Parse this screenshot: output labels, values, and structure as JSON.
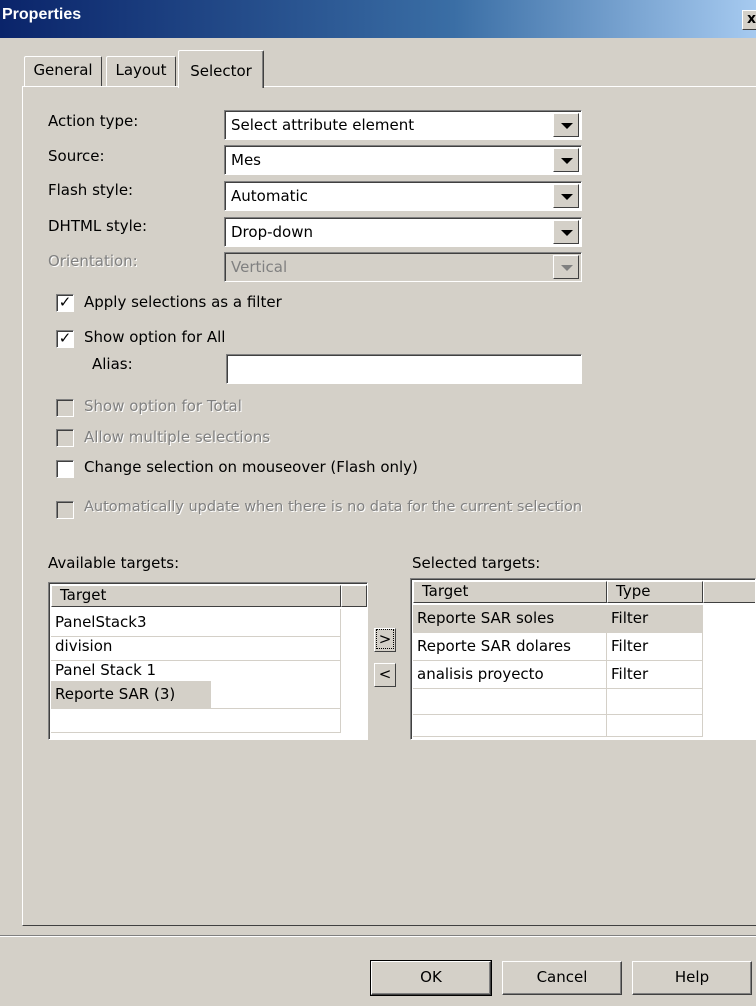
{
  "window": {
    "title": "Properties",
    "close_glyph": "x"
  },
  "tabs": [
    {
      "label": "General"
    },
    {
      "label": "Layout"
    },
    {
      "label": "Selector"
    }
  ],
  "form": {
    "action_type": {
      "label": "Action type:",
      "value": "Select attribute element"
    },
    "source": {
      "label": "Source:",
      "value": "Mes"
    },
    "flash_style": {
      "label": "Flash style:",
      "value": "Automatic"
    },
    "dhtml_style": {
      "label": "DHTML style:",
      "value": "Drop-down"
    },
    "orientation": {
      "label": "Orientation:",
      "value": "Vertical"
    }
  },
  "checks": {
    "apply_filter": {
      "label": "Apply selections as a filter",
      "checked": true
    },
    "show_all": {
      "label": "Show option for All",
      "checked": true
    },
    "alias": {
      "label": "Alias:",
      "value": ""
    },
    "show_total": {
      "label": "Show option for Total",
      "checked": false
    },
    "allow_multiple": {
      "label": "Allow multiple selections",
      "checked": false
    },
    "mouseover": {
      "label": "Change selection on mouseover (Flash only)",
      "checked": false
    },
    "auto_update": {
      "label": "Automatically update when there is no data for the current selection",
      "checked": false
    }
  },
  "available": {
    "label": "Available targets:",
    "header": "Target",
    "items": [
      "PanelStack3",
      "division",
      "Panel Stack 1",
      "Reporte SAR (3)"
    ]
  },
  "selected": {
    "label": "Selected targets:",
    "headers": [
      "Target",
      "Type"
    ],
    "rows": [
      {
        "target": "Reporte SAR soles",
        "type": "Filter"
      },
      {
        "target": "Reporte SAR dolares",
        "type": "Filter"
      },
      {
        "target": "analisis proyecto",
        "type": "Filter"
      }
    ]
  },
  "move_buttons": {
    "add": ">",
    "remove": "<"
  },
  "buttons": {
    "ok": "OK",
    "cancel": "Cancel",
    "help": "Help"
  }
}
